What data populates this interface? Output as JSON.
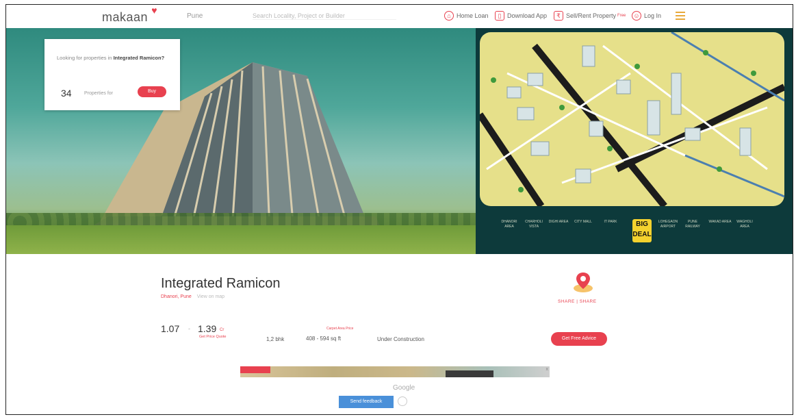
{
  "header": {
    "logo": "makaan",
    "city": "Pune",
    "search_placeholder": "Search Locality, Project or Builder",
    "items": [
      {
        "label": "Home Loan",
        "icon": "home-loan-icon"
      },
      {
        "label": "Download App",
        "icon": "mobile-icon"
      },
      {
        "label": "Sell/Rent Property",
        "badge": "Free",
        "icon": "tag-icon"
      },
      {
        "label": "Log In",
        "icon": "user-icon"
      }
    ]
  },
  "info_card": {
    "question_prefix": "Looking for properties in",
    "question_project": "Integrated Ramicon?",
    "count": "34",
    "count_label": "Properties for",
    "button": "Buy"
  },
  "banner": {
    "strip_items": [
      "DHANORI AREA",
      "CHARHOLI VISTA",
      "DIGHI AREA",
      "CITY MALL",
      "IT PARK",
      "LOHEGAON AIRPORT",
      "PUNE RAILWAY",
      "WAKAD AREA",
      "WAGHOLI AREA"
    ],
    "big_deal": "BIG DEAL"
  },
  "project": {
    "title": "Integrated Ramicon",
    "locality": "Dhanori, Pune",
    "locality_extra": "View on map",
    "share": "SHARE | SHARE",
    "price_low": "1.07",
    "price_sep": "-",
    "price_high": "1.39",
    "price_unit": "Cr",
    "price_link": "Get Price Quote",
    "bhk": "1,2 bhk",
    "size_label": "Carpet Area Price",
    "size": "408 - 594 sq ft",
    "status": "Under Construction",
    "offer_button": "Get Free Advice"
  },
  "ad": {
    "provider": "Google",
    "feedback_button": "Send feedback",
    "close": "x"
  }
}
